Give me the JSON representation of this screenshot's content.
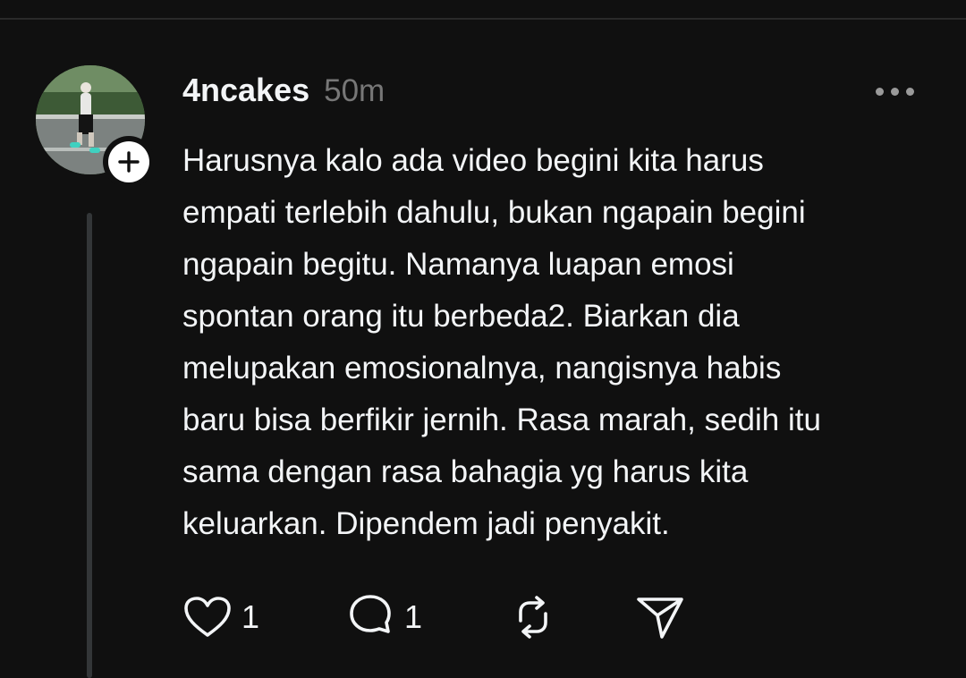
{
  "post": {
    "username": "4ncakes",
    "time": "50m",
    "text": "Harusnya kalo ada video begini kita harus\nempati terlebih dahulu, bukan ngapain begini\nngapain begitu. Namanya luapan  emosi\nspontan orang itu berbeda2. Biarkan dia\nmelupakan emosionalnya, nangisnya habis\nbaru bisa berfikir jernih. Rasa marah, sedih itu\nsama dengan rasa bahagia yg harus kita\nkeluarkan. Dipendem  jadi penyakit."
  },
  "actions": {
    "like_icon": "heart-icon",
    "like_count": "1",
    "reply_icon": "comment-icon",
    "reply_count": "1",
    "repost_icon": "repost-icon",
    "share_icon": "send-icon"
  },
  "colors": {
    "background": "#101010",
    "text": "#f3f5f7",
    "secondary": "#777777"
  }
}
